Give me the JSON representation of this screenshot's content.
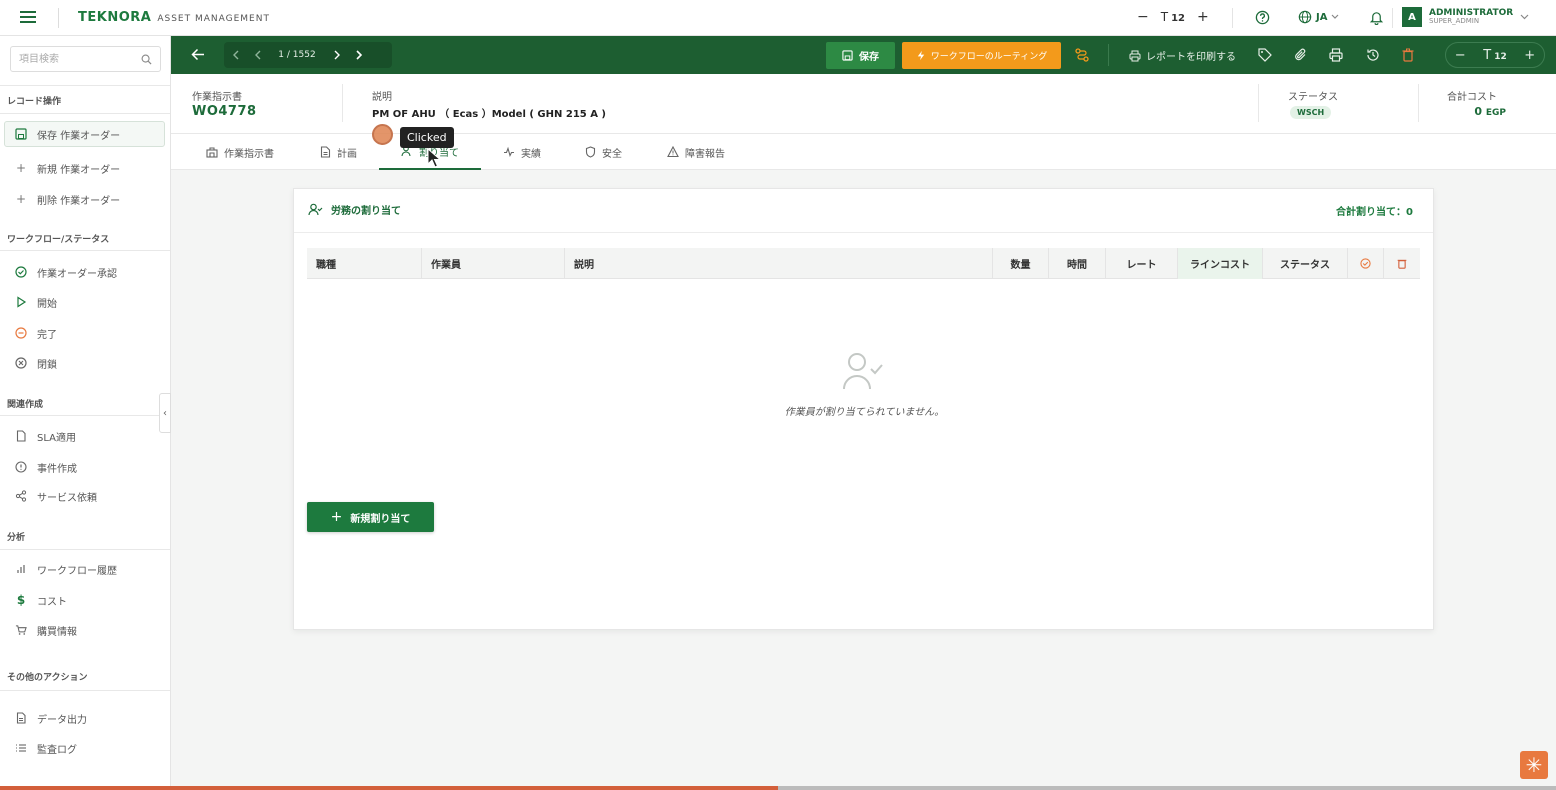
{
  "topbar": {
    "brand_logo": "TEKNORA",
    "brand_sub": "ASSET MANAGEMENT",
    "font_size": "12",
    "font_minus": "−",
    "font_plus": "+",
    "font_icon": "T",
    "lang": "JA",
    "user_initial": "A",
    "user_name": "ADMINISTRATOR",
    "user_role": "SUPER_ADMIN"
  },
  "sidebar": {
    "search_placeholder": "項目検索",
    "sections": {
      "record": "レコード操作",
      "workflow": "ワークフロー/ステータス",
      "related": "関連作成",
      "analysis": "分析",
      "other": "その他のアクション"
    },
    "items": {
      "save": "保存 作業オーダー",
      "new": "新規 作業オーダー",
      "delete": "削除 作業オーダー",
      "approve": "作業オーダー承認",
      "start": "開始",
      "complete": "完了",
      "close": "閉鎖",
      "sla": "SLA適用",
      "incident": "事件作成",
      "service": "サービス依頼",
      "wf_history": "ワークフロー履歴",
      "cost": "コスト",
      "purchase": "購買情報",
      "export": "データ出力",
      "audit": "監査ログ"
    },
    "collapse_icon": "‹"
  },
  "toolbar": {
    "pager": "1 / 1552",
    "save_label": "保存",
    "workflow_label": "ワークフローのルーティング",
    "print_label": "レポートを印刷する",
    "font_size": "12",
    "font_minus": "−",
    "font_plus": "+",
    "font_icon": "T"
  },
  "header": {
    "wo_label": "作業指示書",
    "wo_number": "WO4778",
    "desc_label": "説明",
    "desc_value": "PM OF AHU （ Ecas ）Model ( GHN 215 A )",
    "status_label": "ステータス",
    "status_value": "WSCH",
    "cost_label": "合計コスト",
    "cost_value": "0",
    "cost_currency": "EGP"
  },
  "tabs": [
    {
      "label": "作業指示書"
    },
    {
      "label": "計画"
    },
    {
      "label": "割り当て"
    },
    {
      "label": "実績"
    },
    {
      "label": "安全"
    },
    {
      "label": "障害報告"
    }
  ],
  "card": {
    "title": "労務の割り当て",
    "total": "合計割り当て：0",
    "columns": [
      "職種",
      "作業員",
      "説明",
      "数量",
      "時間",
      "レート",
      "ラインコスト",
      "ステータス"
    ],
    "empty_text": "作業員が割り当てられていません。",
    "new_button": "新規割り当て"
  },
  "overlay": {
    "tooltip": "Clicked",
    "progress_fraction": 0.5
  },
  "colors": {
    "brand_green": "#1d5e31",
    "accent_orange": "#f39a1b",
    "save_green": "#2d8a44"
  }
}
